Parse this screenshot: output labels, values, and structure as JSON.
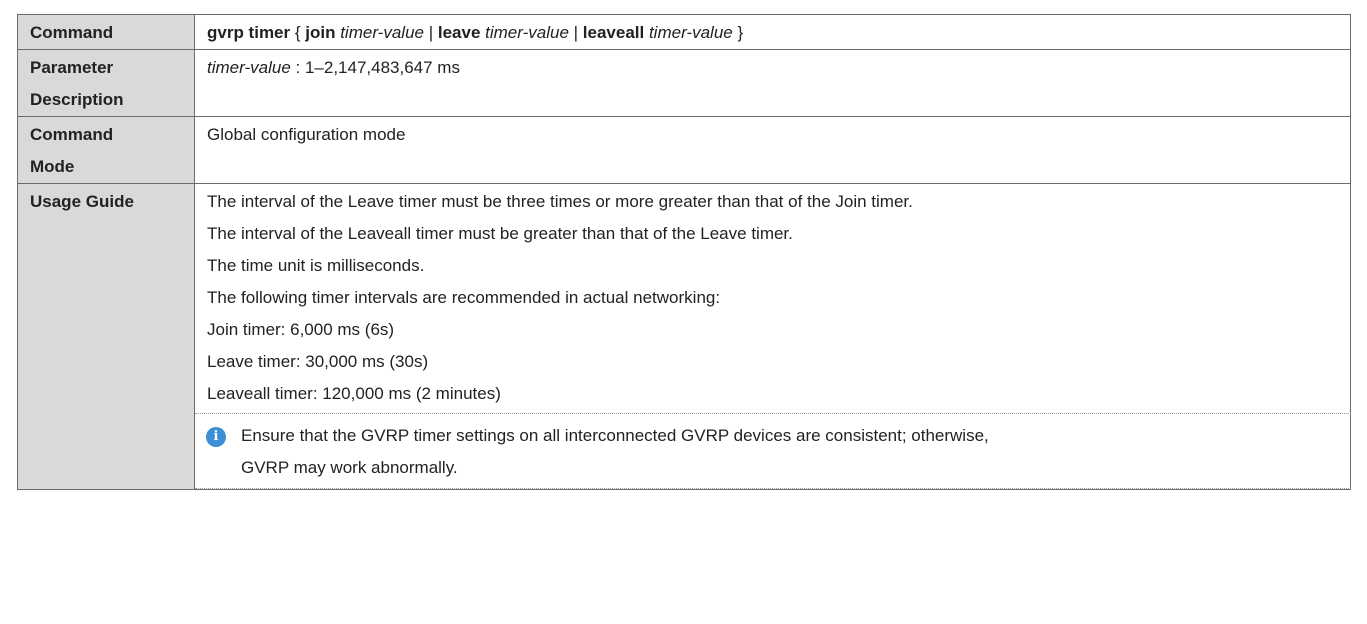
{
  "rows": {
    "command": {
      "label": "Command",
      "syntax": {
        "cmd": "gvrp timer",
        "open": " { ",
        "join_kw": "join",
        "join_arg": " timer-value",
        "sep1": " | ",
        "leave_kw": "leave",
        "leave_arg": " timer-value",
        "sep2": " | ",
        "leaveall_kw": "leaveall",
        "leaveall_arg": " timer-value",
        "close": " }"
      }
    },
    "parameter": {
      "label_line1": "Parameter",
      "label_line2": "Description",
      "param_name": "timer-value",
      "param_desc": " : 1–2,147,483,647 ms"
    },
    "mode": {
      "label_line1": "Command",
      "label_line2": "Mode",
      "value": "Global configuration mode"
    },
    "usage": {
      "label": "Usage Guide",
      "lines": [
        "The interval of the Leave timer must be three times or more greater than that of the Join timer.",
        "The interval of the Leaveall timer must be greater than that of the Leave timer.",
        "The time unit is milliseconds.",
        "The following timer intervals are recommended in actual networking:",
        "Join timer: 6,000 ms (6s)",
        "Leave timer: 30,000 ms (30s)",
        "Leaveall timer: 120,000 ms (2 minutes)"
      ],
      "note": {
        "icon": "info-icon",
        "icon_color": "#3b8fd6",
        "line1": "Ensure that the GVRP timer settings on all interconnected GVRP devices are consistent; otherwise,",
        "line2": "GVRP may work abnormally."
      }
    }
  }
}
